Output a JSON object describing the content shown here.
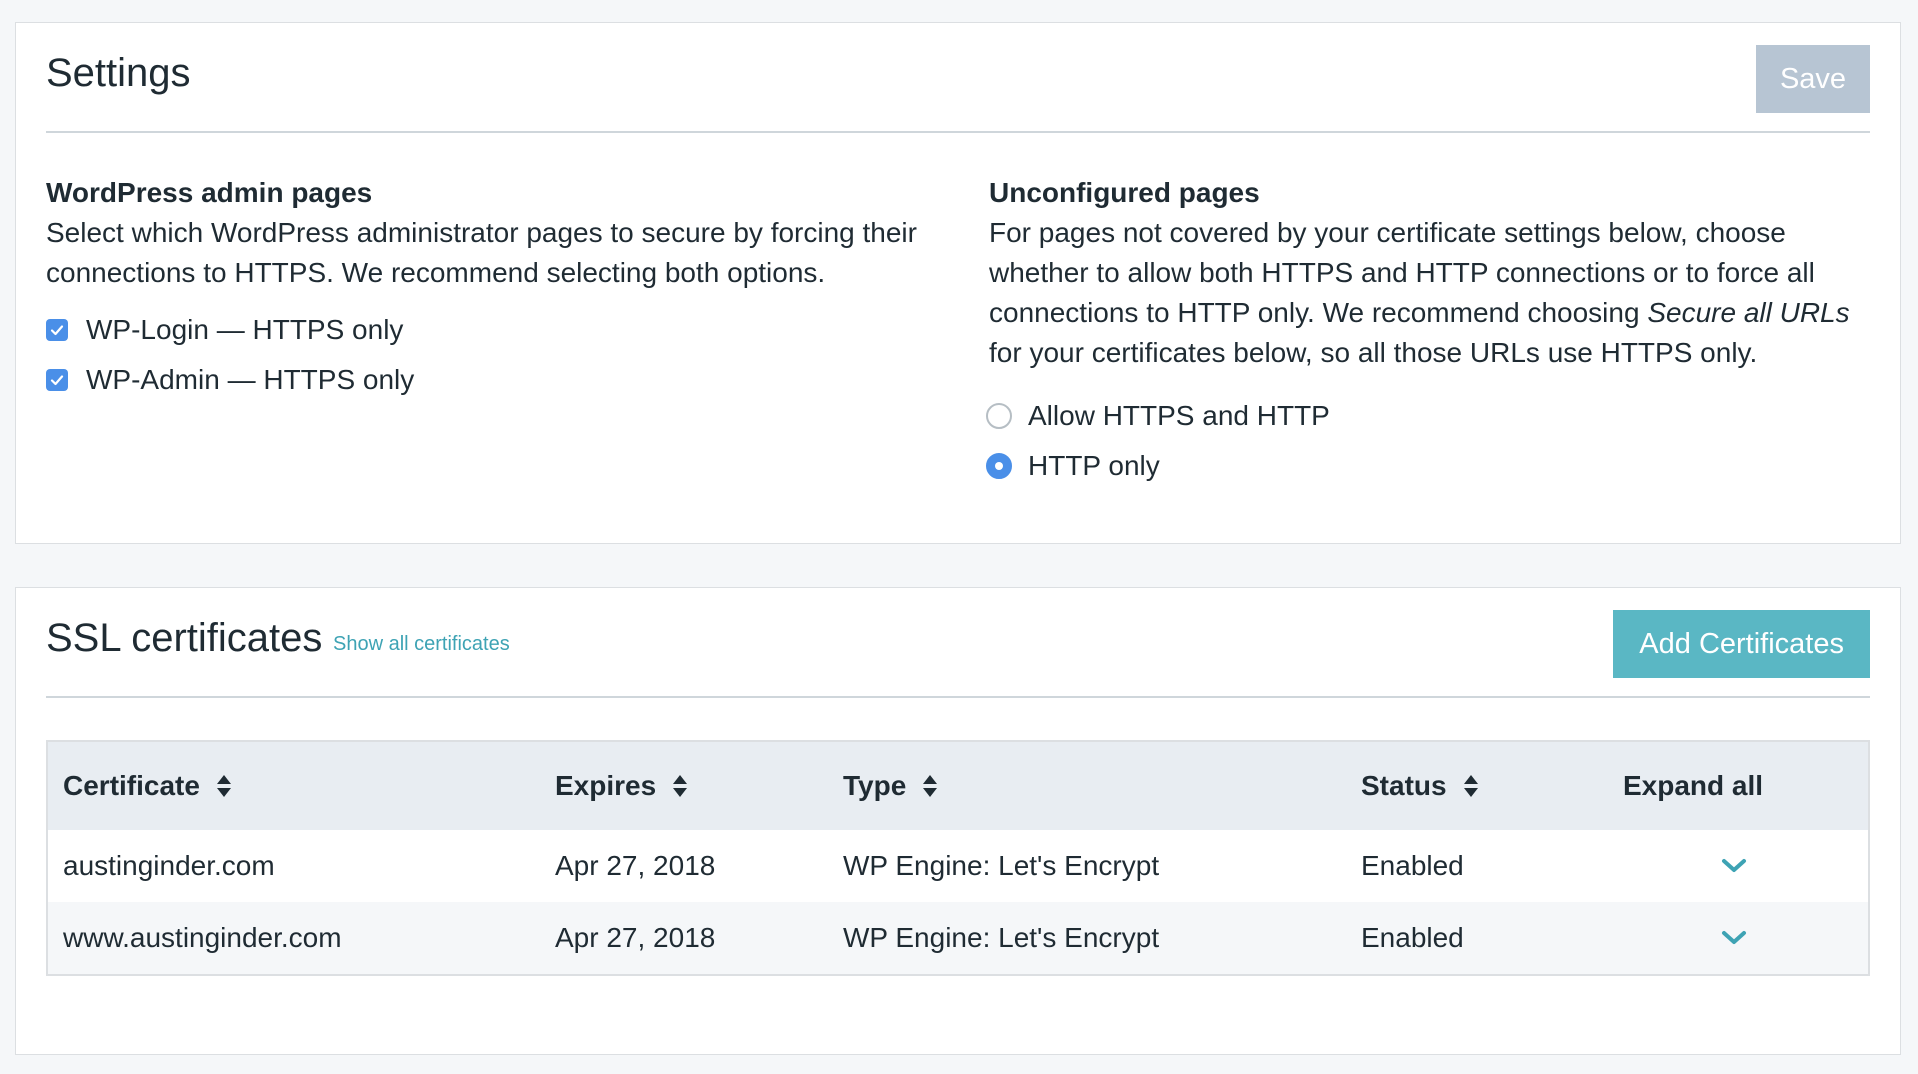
{
  "settings": {
    "title": "Settings",
    "save_label": "Save",
    "wp_admin": {
      "heading": "WordPress admin pages",
      "description": "Select which WordPress administrator pages to secure by forcing their connections to HTTPS. We recommend selecting both options.",
      "options": [
        {
          "label": "WP-Login — HTTPS only",
          "checked": true
        },
        {
          "label": "WP-Admin — HTTPS only",
          "checked": true
        }
      ]
    },
    "unconfigured": {
      "heading": "Unconfigured pages",
      "description_before": "For pages not covered by your certificate settings below, choose whether to allow both HTTPS and HTTP connections or to force all connections to HTTP only. We recommend choosing ",
      "description_emphasis": "Secure all URLs",
      "description_after": " for your certificates below, so all those URLs use HTTPS only.",
      "options": [
        {
          "label": "Allow HTTPS and HTTP",
          "selected": false
        },
        {
          "label": "HTTP only",
          "selected": true
        }
      ]
    }
  },
  "ssl": {
    "title": "SSL certificates",
    "show_all_label": "Show all certificates",
    "add_label": "Add Certificates",
    "columns": {
      "certificate": "Certificate",
      "expires": "Expires",
      "type": "Type",
      "status": "Status",
      "expand_all": "Expand all"
    },
    "rows": [
      {
        "certificate": "austinginder.com",
        "expires": "Apr 27, 2018",
        "type": "WP Engine: Let's Encrypt",
        "status": "Enabled"
      },
      {
        "certificate": "www.austinginder.com",
        "expires": "Apr 27, 2018",
        "type": "WP Engine: Let's Encrypt",
        "status": "Enabled"
      }
    ]
  },
  "colors": {
    "accent_teal": "#5ab7c4",
    "link_teal": "#3ea3b4",
    "checkbox_blue": "#4a8fe8",
    "save_disabled": "#b7c5d3"
  },
  "icons": {
    "checkbox": "checkmark-icon",
    "sort": "sort-arrows-icon",
    "expand": "chevron-down-icon"
  }
}
